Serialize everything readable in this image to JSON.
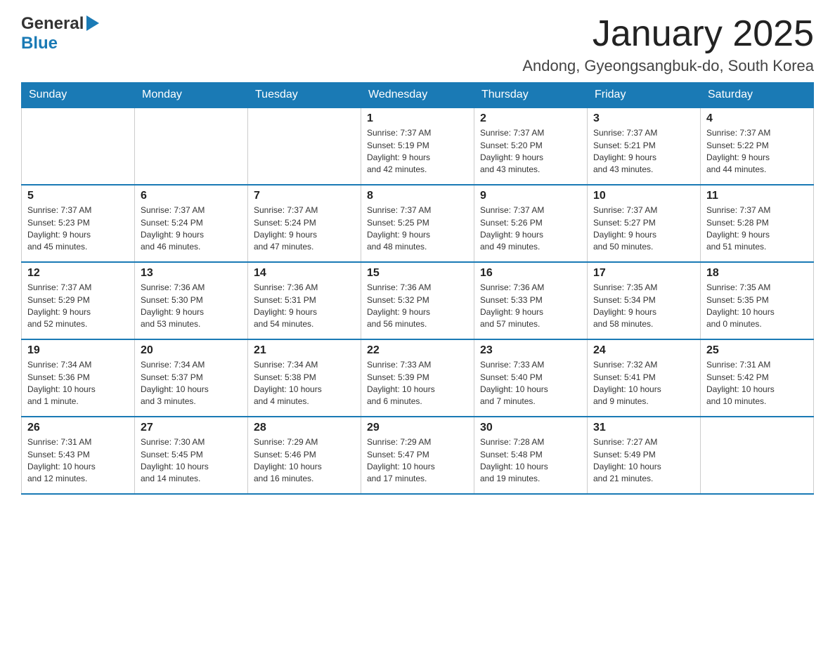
{
  "header": {
    "logo_line1": "General",
    "logo_line2": "Blue",
    "title": "January 2025",
    "subtitle": "Andong, Gyeongsangbuk-do, South Korea"
  },
  "calendar": {
    "days_of_week": [
      "Sunday",
      "Monday",
      "Tuesday",
      "Wednesday",
      "Thursday",
      "Friday",
      "Saturday"
    ],
    "weeks": [
      [
        {
          "day": "",
          "info": ""
        },
        {
          "day": "",
          "info": ""
        },
        {
          "day": "",
          "info": ""
        },
        {
          "day": "1",
          "info": "Sunrise: 7:37 AM\nSunset: 5:19 PM\nDaylight: 9 hours\nand 42 minutes."
        },
        {
          "day": "2",
          "info": "Sunrise: 7:37 AM\nSunset: 5:20 PM\nDaylight: 9 hours\nand 43 minutes."
        },
        {
          "day": "3",
          "info": "Sunrise: 7:37 AM\nSunset: 5:21 PM\nDaylight: 9 hours\nand 43 minutes."
        },
        {
          "day": "4",
          "info": "Sunrise: 7:37 AM\nSunset: 5:22 PM\nDaylight: 9 hours\nand 44 minutes."
        }
      ],
      [
        {
          "day": "5",
          "info": "Sunrise: 7:37 AM\nSunset: 5:23 PM\nDaylight: 9 hours\nand 45 minutes."
        },
        {
          "day": "6",
          "info": "Sunrise: 7:37 AM\nSunset: 5:24 PM\nDaylight: 9 hours\nand 46 minutes."
        },
        {
          "day": "7",
          "info": "Sunrise: 7:37 AM\nSunset: 5:24 PM\nDaylight: 9 hours\nand 47 minutes."
        },
        {
          "day": "8",
          "info": "Sunrise: 7:37 AM\nSunset: 5:25 PM\nDaylight: 9 hours\nand 48 minutes."
        },
        {
          "day": "9",
          "info": "Sunrise: 7:37 AM\nSunset: 5:26 PM\nDaylight: 9 hours\nand 49 minutes."
        },
        {
          "day": "10",
          "info": "Sunrise: 7:37 AM\nSunset: 5:27 PM\nDaylight: 9 hours\nand 50 minutes."
        },
        {
          "day": "11",
          "info": "Sunrise: 7:37 AM\nSunset: 5:28 PM\nDaylight: 9 hours\nand 51 minutes."
        }
      ],
      [
        {
          "day": "12",
          "info": "Sunrise: 7:37 AM\nSunset: 5:29 PM\nDaylight: 9 hours\nand 52 minutes."
        },
        {
          "day": "13",
          "info": "Sunrise: 7:36 AM\nSunset: 5:30 PM\nDaylight: 9 hours\nand 53 minutes."
        },
        {
          "day": "14",
          "info": "Sunrise: 7:36 AM\nSunset: 5:31 PM\nDaylight: 9 hours\nand 54 minutes."
        },
        {
          "day": "15",
          "info": "Sunrise: 7:36 AM\nSunset: 5:32 PM\nDaylight: 9 hours\nand 56 minutes."
        },
        {
          "day": "16",
          "info": "Sunrise: 7:36 AM\nSunset: 5:33 PM\nDaylight: 9 hours\nand 57 minutes."
        },
        {
          "day": "17",
          "info": "Sunrise: 7:35 AM\nSunset: 5:34 PM\nDaylight: 9 hours\nand 58 minutes."
        },
        {
          "day": "18",
          "info": "Sunrise: 7:35 AM\nSunset: 5:35 PM\nDaylight: 10 hours\nand 0 minutes."
        }
      ],
      [
        {
          "day": "19",
          "info": "Sunrise: 7:34 AM\nSunset: 5:36 PM\nDaylight: 10 hours\nand 1 minute."
        },
        {
          "day": "20",
          "info": "Sunrise: 7:34 AM\nSunset: 5:37 PM\nDaylight: 10 hours\nand 3 minutes."
        },
        {
          "day": "21",
          "info": "Sunrise: 7:34 AM\nSunset: 5:38 PM\nDaylight: 10 hours\nand 4 minutes."
        },
        {
          "day": "22",
          "info": "Sunrise: 7:33 AM\nSunset: 5:39 PM\nDaylight: 10 hours\nand 6 minutes."
        },
        {
          "day": "23",
          "info": "Sunrise: 7:33 AM\nSunset: 5:40 PM\nDaylight: 10 hours\nand 7 minutes."
        },
        {
          "day": "24",
          "info": "Sunrise: 7:32 AM\nSunset: 5:41 PM\nDaylight: 10 hours\nand 9 minutes."
        },
        {
          "day": "25",
          "info": "Sunrise: 7:31 AM\nSunset: 5:42 PM\nDaylight: 10 hours\nand 10 minutes."
        }
      ],
      [
        {
          "day": "26",
          "info": "Sunrise: 7:31 AM\nSunset: 5:43 PM\nDaylight: 10 hours\nand 12 minutes."
        },
        {
          "day": "27",
          "info": "Sunrise: 7:30 AM\nSunset: 5:45 PM\nDaylight: 10 hours\nand 14 minutes."
        },
        {
          "day": "28",
          "info": "Sunrise: 7:29 AM\nSunset: 5:46 PM\nDaylight: 10 hours\nand 16 minutes."
        },
        {
          "day": "29",
          "info": "Sunrise: 7:29 AM\nSunset: 5:47 PM\nDaylight: 10 hours\nand 17 minutes."
        },
        {
          "day": "30",
          "info": "Sunrise: 7:28 AM\nSunset: 5:48 PM\nDaylight: 10 hours\nand 19 minutes."
        },
        {
          "day": "31",
          "info": "Sunrise: 7:27 AM\nSunset: 5:49 PM\nDaylight: 10 hours\nand 21 minutes."
        },
        {
          "day": "",
          "info": ""
        }
      ]
    ]
  }
}
